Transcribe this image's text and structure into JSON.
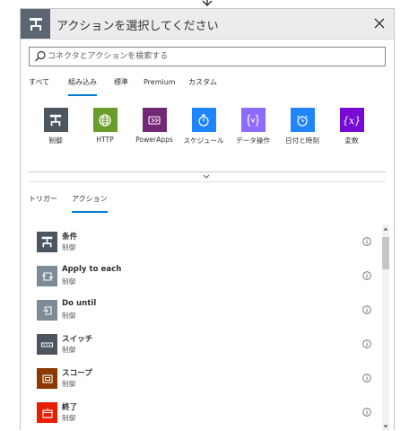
{
  "header": {
    "title": "アクションを選択してください",
    "icon": "control-icon",
    "icon_bg": "#5b6672"
  },
  "search": {
    "placeholder": "コネクタとアクションを検索する",
    "value": ""
  },
  "tabs": [
    {
      "label": "すべて",
      "active": false
    },
    {
      "label": "組み込み",
      "active": true
    },
    {
      "label": "標準",
      "active": false
    },
    {
      "label": "Premium",
      "active": false
    },
    {
      "label": "カスタム",
      "active": false
    }
  ],
  "connectors": [
    {
      "label": "制御",
      "color": "#4d555e",
      "icon": "control-icon"
    },
    {
      "label": "HTTP",
      "color": "#6a9e2a",
      "icon": "globe-icon"
    },
    {
      "label": "PowerApps",
      "color": "#742774",
      "icon": "powerapps-icon"
    },
    {
      "label": "スケジュール",
      "color": "#1f85ff",
      "icon": "stopwatch-icon"
    },
    {
      "label": "データ操作",
      "color": "#8c6cff",
      "icon": "data-operation-icon"
    },
    {
      "label": "日付と時刻",
      "color": "#1f85ff",
      "icon": "clock-icon"
    },
    {
      "label": "変数",
      "color": "#770bd6",
      "icon": "variable-icon"
    }
  ],
  "subtabs": [
    {
      "label": "トリガー",
      "active": false
    },
    {
      "label": "アクション",
      "active": true
    }
  ],
  "actions": [
    {
      "name": "条件",
      "category": "制御",
      "color": "#4d555e",
      "icon": "condition-icon"
    },
    {
      "name": "Apply to each",
      "category": "制御",
      "color": "#7e8a96",
      "icon": "loop-icon"
    },
    {
      "name": "Do until",
      "category": "制御",
      "color": "#7e8a96",
      "icon": "do-until-icon"
    },
    {
      "name": "スイッチ",
      "category": "制御",
      "color": "#4d555e",
      "icon": "switch-icon"
    },
    {
      "name": "スコープ",
      "category": "制御",
      "color": "#8c3900",
      "icon": "scope-icon"
    },
    {
      "name": "終了",
      "category": "制御",
      "color": "#e81e00",
      "icon": "terminate-icon"
    }
  ],
  "colors": {
    "accent": "#0078d4",
    "header_bg": "#ececec",
    "border": "#c8c6c4"
  }
}
